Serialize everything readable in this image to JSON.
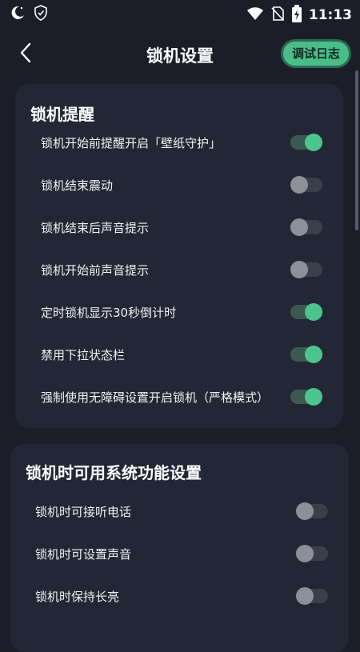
{
  "status_bar": {
    "time": "11:13",
    "icons": [
      "moon-icon",
      "shield-icon",
      "wifi-icon",
      "no-sim-icon",
      "battery-charging-icon"
    ]
  },
  "header": {
    "title": "锁机设置",
    "back_icon": "back-arrow-icon",
    "debug_label": "调试日志"
  },
  "colors": {
    "background": "#1b1e29",
    "card": "#232735",
    "accent": "#4cc58c",
    "toggle_off": "#8d8f99"
  },
  "sections": [
    {
      "title": "锁机提醒",
      "items": [
        {
          "label": "锁机开始前提醒开启「壁纸守护」",
          "on": true
        },
        {
          "label": "锁机结束震动",
          "on": false
        },
        {
          "label": "锁机结束后声音提示",
          "on": false
        },
        {
          "label": "锁机开始前声音提示",
          "on": false
        },
        {
          "label": "定时锁机显示30秒倒计时",
          "on": true
        },
        {
          "label": "禁用下拉状态栏",
          "on": true
        },
        {
          "label": "强制使用无障碍设置开启锁机（严格模式）",
          "on": true
        }
      ]
    },
    {
      "title": "锁机时可用系统功能设置",
      "items": [
        {
          "label": "锁机时可接听电话",
          "on": false
        },
        {
          "label": "锁机时可设置声音",
          "on": false
        },
        {
          "label": "锁机时保持长亮",
          "on": false
        }
      ]
    }
  ]
}
